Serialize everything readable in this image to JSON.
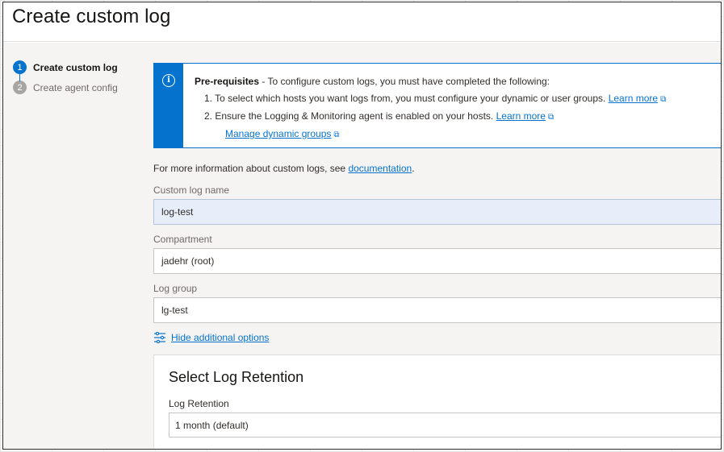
{
  "page": {
    "title": "Create custom log"
  },
  "steps": [
    {
      "number": "1",
      "label": "Create custom log"
    },
    {
      "number": "2",
      "label": "Create agent config"
    }
  ],
  "notice": {
    "icon": "info-icon",
    "title": "Pre-requisites",
    "intro": " - To configure custom logs, you must have completed the following:",
    "item1_text": "1. To select which hosts you want logs from, you must configure your dynamic or user groups.",
    "item1_link": "Learn more",
    "item2_text": "2. Ensure the Logging & Monitoring agent is enabled on your hosts.",
    "item2_link": "Learn more",
    "manage_link": "Manage dynamic groups"
  },
  "more_info": {
    "text": "For more information about custom logs, see ",
    "link": "documentation",
    "end": "."
  },
  "form": {
    "custom_log_name": {
      "label": "Custom log name",
      "value": "log-test"
    },
    "compartment": {
      "label": "Compartment",
      "value": "jadehr (root)"
    },
    "log_group": {
      "label": "Log group",
      "value": "lg-test"
    },
    "options_toggle": "Hide additional options"
  },
  "retention": {
    "title": "Select Log Retention",
    "label": "Log Retention",
    "value": "1 month (default)"
  },
  "colors": {
    "accent": "#0572ce",
    "page_bg": "#f5f4f2"
  }
}
